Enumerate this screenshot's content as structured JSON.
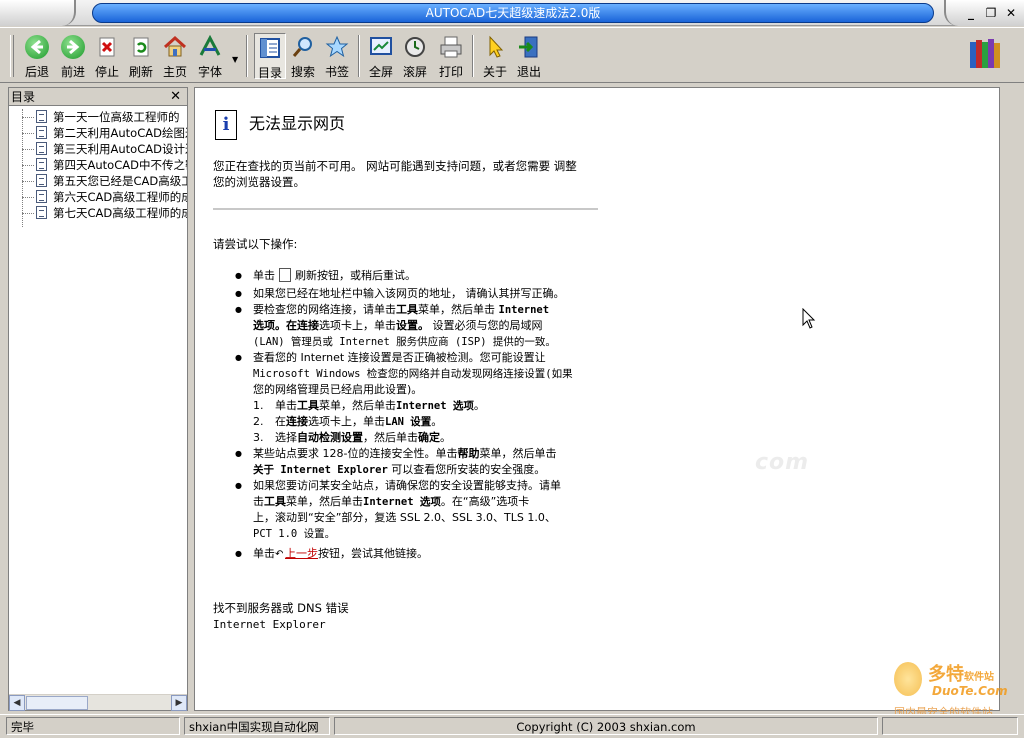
{
  "window": {
    "title": "AUTOCAD七天超级速成法2.0版",
    "minimize": "_",
    "restore": "❐",
    "close": "✕"
  },
  "toolbar": {
    "items": [
      {
        "label": "后退",
        "icon": "back-arrow-icon"
      },
      {
        "label": "前进",
        "icon": "forward-arrow-icon"
      },
      {
        "label": "停止",
        "icon": "stop-icon"
      },
      {
        "label": "刷新",
        "icon": "refresh-icon"
      },
      {
        "label": "主页",
        "icon": "home-icon"
      },
      {
        "label": "字体",
        "icon": "font-icon"
      },
      {
        "label": "目录",
        "icon": "contents-icon"
      },
      {
        "label": "搜索",
        "icon": "search-icon"
      },
      {
        "label": "书签",
        "icon": "bookmark-star-icon"
      },
      {
        "label": "全屏",
        "icon": "fullscreen-icon"
      },
      {
        "label": "滚屏",
        "icon": "scroll-icon"
      },
      {
        "label": "打印",
        "icon": "print-icon"
      },
      {
        "label": "关于",
        "icon": "about-icon"
      },
      {
        "label": "退出",
        "icon": "exit-icon"
      }
    ]
  },
  "sidebar": {
    "title": "目录",
    "close": "✕",
    "items": [
      "第一天一位高级工程师的",
      "第二天利用AutoCAD绘图过",
      "第三天利用AutoCAD设计过",
      "第四天AutoCAD中不传之密",
      "第五天您已经是CAD高级工",
      "第六天CAD高级工程师的成",
      "第七天CAD高级工程师的成"
    ]
  },
  "page": {
    "heading": "无法显示网页",
    "intro_line1": "您正在查找的页当前不可用。 网站可能遇到支持问题，或者您需要 调整",
    "intro_line2": "您的浏览器设置。",
    "try_label": "请尝试以下操作:",
    "b1_pre": "单击",
    "b1_post": "刷新按钮，或稍后重试。",
    "b2": "如果您已经在地址栏中输入该网页的地址， 请确认其拼写正确。",
    "b3_l1a": "要检查您的网络连接，请单击",
    "b3_l1b": "工具",
    "b3_l1c": "菜单，然后单击",
    "b3_l1d": "Internet",
    "b3_l2a": "选项。在",
    "b3_l2b": "连接",
    "b3_l2c": "选项卡上，单击",
    "b3_l2d": "设置。",
    "b3_l2e": " 设置必须与您的局域网",
    "b3_l3": "(LAN) 管理员或 Internet 服务供应商 (ISP) 提供的一致。",
    "b4_l1": "查看您的 Internet 连接设置是否正确被检测。您可能设置让",
    "b4_l2": "Microsoft Windows 检查您的网络并自动发现网络连接设置(如果",
    "b4_l3": "您的网络管理员已经启用此设置)。",
    "n1_num": "1.",
    "n1a": "单击",
    "n1b": "工具",
    "n1c": "菜单，然后单击",
    "n1d": "Internet 选项",
    "n1e": "。",
    "n2_num": "2.",
    "n2a": "在",
    "n2b": "连接",
    "n2c": "选项卡上，单击",
    "n2d": "LAN 设置",
    "n2e": "。",
    "n3_num": "3.",
    "n3a": "选择",
    "n3b": "自动检测设置",
    "n3c": "，然后单击",
    "n3d": "确定",
    "n3e": "。",
    "b5_l1a": "某些站点要求 128-位的连接安全性。单击",
    "b5_l1b": "帮助",
    "b5_l1c": "菜单，然后单击",
    "b5_l2a": "关于 Internet Explorer",
    "b5_l2b": " 可以查看您所安装的安全强度。",
    "b6_l1": "如果您要访问某安全站点，请确保您的安全设置能够支持。请单",
    "b6_l2a": "击",
    "b6_l2b": "工具",
    "b6_l2c": "菜单，然后单击",
    "b6_l2d": "Internet 选项",
    "b6_l2e": "。在“高级”选项卡",
    "b6_l3": "上，滚动到“安全”部分，复选 SSL 2.0、SSL 3.0、TLS 1.0、",
    "b6_l4": "PCT 1.0 设置。",
    "b7_pre": "单击",
    "b7_link": "上一步",
    "b7_post": "按钮，尝试其他链接。",
    "footer1": "找不到服务器或 DNS 错误",
    "footer2": "Internet Explorer"
  },
  "statusbar": {
    "status": "完毕",
    "site": "shxian中国实现自动化网",
    "copyright": "Copyright (C) 2003 shxian.com"
  },
  "watermark": {
    "brand": "多特",
    "brand_sub": "软件站",
    "url": "DuoTe.Com",
    "slogan": "国内最安全的软件站",
    "center": "com"
  }
}
